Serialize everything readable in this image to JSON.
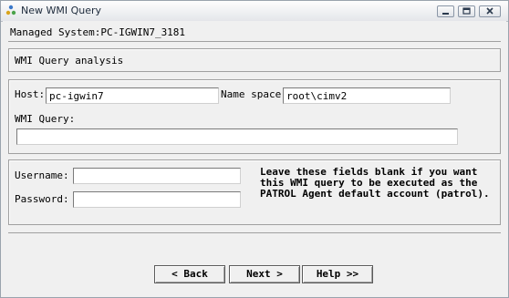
{
  "window": {
    "title": "New WMI Query",
    "icon": "bmc-patrol-icon",
    "controls": [
      "minimize-icon",
      "maximize-icon",
      "close-icon"
    ]
  },
  "header": {
    "managed_system": "Managed System:PC-IGWIN7_3181"
  },
  "section": {
    "title": "WMI Query analysis"
  },
  "query": {
    "host_label": "Host:",
    "host_value": "pc-igwin7",
    "namespace_label": "Name space:",
    "namespace_value": "root\\cimv2",
    "wmi_query_label": "WMI Query:",
    "wmi_query_value": ""
  },
  "credentials": {
    "username_label": "Username:",
    "username_value": "",
    "password_label": "Password:",
    "password_value": "",
    "hint": "Leave these fields blank if you want this WMI query to be executed as the PATROL Agent default account (patrol)."
  },
  "buttons": {
    "back": "< Back",
    "next": "Next >",
    "help": "Help >>"
  }
}
